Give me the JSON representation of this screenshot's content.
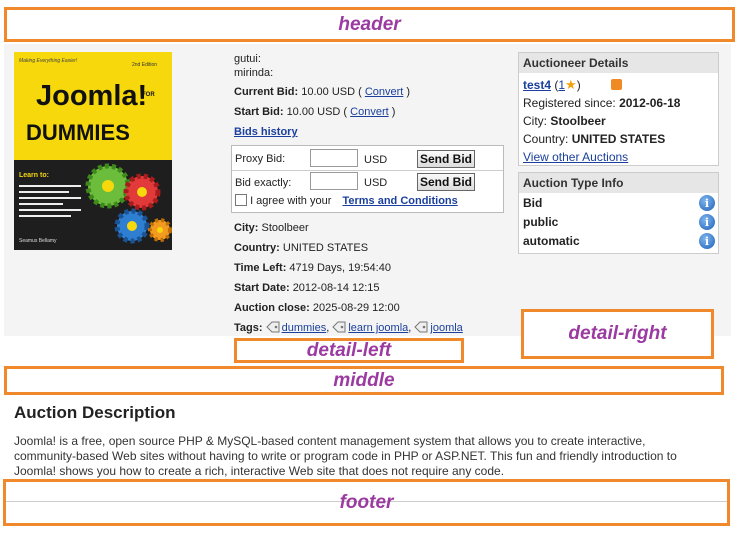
{
  "regions": {
    "header": "header",
    "detail_left": "detail-left",
    "detail_right": "detail-right",
    "middle": "middle",
    "footer": "footer"
  },
  "book_cover": {
    "tagline": "Making Everything Easier!",
    "edition": "2nd Edition",
    "title": "Joomla!",
    "for": "FOR",
    "dummies": "DUMMIES",
    "learn_to": "Learn to:",
    "author": "Seamus Bellamy"
  },
  "auction": {
    "user1": "gutui:",
    "user2": "mirinda:",
    "current_bid_label": "Current Bid:",
    "current_bid_value": "10.00 USD (",
    "convert1": "Convert",
    "close_paren1": ")",
    "start_bid_label": "Start Bid:",
    "start_bid_value": "10.00 USD (",
    "convert2": "Convert",
    "close_paren2": ")",
    "bids_history": "Bids history",
    "proxy_bid_label": "Proxy Bid:",
    "proxy_currency": "USD",
    "send_bid_1": "Send Bid",
    "bid_exactly_label": "Bid exactly:",
    "exact_currency": "USD",
    "send_bid_2": "Send Bid",
    "agree_text": "I agree with your",
    "terms_link": "Terms and Conditions",
    "city_label": "City:",
    "city_value": "Stoolbeer",
    "country_label": "Country:",
    "country_value": "UNITED STATES",
    "time_left_label": "Time Left:",
    "time_left_value": "4719 Days, 19:54:40",
    "start_date_label": "Start Date:",
    "start_date_value": "2012-08-14 12:15",
    "close_label": "Auction close:",
    "close_value": "2025-08-29 12:00",
    "tags_label": "Tags:",
    "tags": [
      "dummies",
      "learn joomla",
      "joomla"
    ],
    "tag_sep": ","
  },
  "auctioneer": {
    "heading": "Auctioneer Details",
    "name": "test4",
    "rating_open": "(",
    "rating": "1",
    "rating_close": ")",
    "registered_label": "Registered since:",
    "registered_value": "2012-06-18",
    "city_label": "City:",
    "city_value": "Stoolbeer",
    "country_label": "Country:",
    "country_value": "UNITED STATES",
    "other_auctions": "View other Auctions"
  },
  "auction_type": {
    "heading": "Auction Type Info",
    "items": [
      "Bid",
      "public",
      "automatic"
    ]
  },
  "description": {
    "heading": "Auction Description",
    "line1": "Joomla! is a free, open source PHP & MySQL-based content management system that allows you to create interactive,",
    "line2": "community-based Web sites without having to write or program code in PHP or ASP.NET. This fun and friendly introduction to",
    "line3": "Joomla! shows you how to create a rich, interactive Web site that does not require any code."
  },
  "colors": {
    "region_border": "#f0882c",
    "region_text": "#9b3aa0",
    "link": "#1a3f9c"
  }
}
